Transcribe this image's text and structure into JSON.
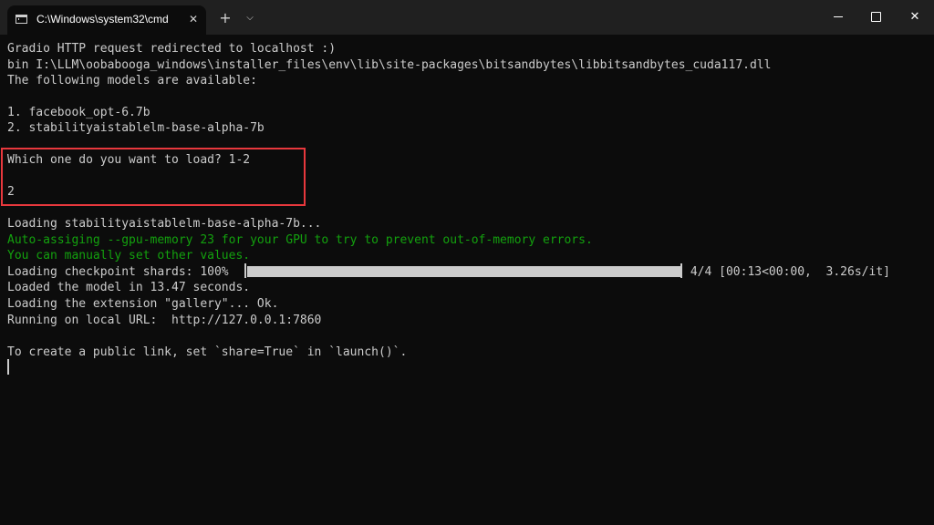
{
  "window": {
    "tab_title": "C:\\Windows\\system32\\cmd",
    "tab_close_icon": "close-icon",
    "new_tab_icon": "plus-icon",
    "dropdown_icon": "chevron-down-icon",
    "controls": [
      "minimize",
      "maximize",
      "close"
    ]
  },
  "terminal": {
    "lines": {
      "l1": "Gradio HTTP request redirected to localhost :)",
      "l2": "bin I:\\LLM\\oobabooga_windows\\installer_files\\env\\lib\\site-packages\\bitsandbytes\\libbitsandbytes_cuda117.dll",
      "l3": "The following models are available:",
      "l4": "1. facebook_opt-6.7b",
      "l5": "2. stabilityaistablelm-base-alpha-7b",
      "l6": "Which one do you want to load? 1-2",
      "l7": "2",
      "l8": "Loading stabilityaistablelm-base-alpha-7b...",
      "l9": "Auto-assiging --gpu-memory 23 for your GPU to try to prevent out-of-memory errors.",
      "l10": "You can manually set other values.",
      "l11_prefix": "Loading checkpoint shards: 100%",
      "l11_suffix": " 4/4 [00:13<00:00,  3.26s/it]",
      "l12": "Loaded the model in 13.47 seconds.",
      "l13": "Loading the extension \"gallery\"... Ok.",
      "l14": "Running on local URL:  http://127.0.0.1:7860",
      "l15": "To create a public link, set `share=True` in `launch()`."
    },
    "progress_fraction": 1.0,
    "colors": {
      "background": "#0c0c0c",
      "text": "#cccccc",
      "warning_green": "#13a10e",
      "highlight_border": "#e8383d"
    }
  }
}
